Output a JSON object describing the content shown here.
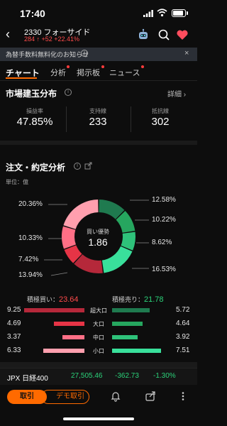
{
  "status_bar": {
    "time": "17:40"
  },
  "header": {
    "code": "2330",
    "name": "フォーサイド",
    "quote": "284 ↑ +52 +22.41%"
  },
  "notice": {
    "text": "為替手数料無料化のお知らせ"
  },
  "tabs": [
    {
      "label": "チャート",
      "active": true
    },
    {
      "label": "分析",
      "dot": true
    },
    {
      "label": "掲示板",
      "dot": true
    },
    {
      "label": "ニュース",
      "dot": true
    }
  ],
  "market_distribution": {
    "title": "市場建玉分布",
    "detail_link": "詳細",
    "stats": [
      {
        "label": "損益率",
        "value": "47.85%"
      },
      {
        "label": "支持線",
        "value": "233"
      },
      {
        "label": "抵抗線",
        "value": "302"
      }
    ]
  },
  "order_analysis": {
    "title": "注文・約定分析",
    "unit": "単位：億",
    "center_label": "買い優勢",
    "center_value": "1.86",
    "left_labels": [
      "20.36%",
      "10.33%",
      "7.42%",
      "13.94%"
    ],
    "right_labels": [
      "12.58%",
      "10.22%",
      "8.62%",
      "16.53%"
    ],
    "colors": {
      "buy": [
        "#b5283a",
        "#e63446",
        "#ff6f86",
        "#ff9fae"
      ],
      "sell": [
        "#1f7a4f",
        "#26a65f",
        "#2ec27a",
        "#39e09b"
      ]
    },
    "donut": {
      "sell_pct": [
        12.58,
        10.22,
        8.62,
        16.53
      ],
      "buy_pct": [
        13.94,
        7.42,
        10.33,
        20.36
      ]
    },
    "buy_total_label": "積極買い：",
    "buy_total": "23.64",
    "sell_total_label": "積極売り：",
    "sell_total": "21.78",
    "rows": [
      {
        "buy": "9.25",
        "cat": "超大口",
        "sell": "5.72",
        "buy_v": 9.25,
        "sell_v": 5.72
      },
      {
        "buy": "4.69",
        "cat": "大口",
        "sell": "4.64",
        "buy_v": 4.69,
        "sell_v": 4.64
      },
      {
        "buy": "3.37",
        "cat": "中口",
        "sell": "3.92",
        "buy_v": 3.37,
        "sell_v": 3.92
      },
      {
        "buy": "6.33",
        "cat": "小口",
        "sell": "7.51",
        "buy_v": 6.33,
        "sell_v": 7.51
      }
    ]
  },
  "index_quote": {
    "name": "JPX 日経400",
    "price": "27,505.46",
    "change": "-362.73",
    "pct": "-1.30%"
  },
  "footer": {
    "trade": "取引",
    "demo": "デモ取引"
  }
}
